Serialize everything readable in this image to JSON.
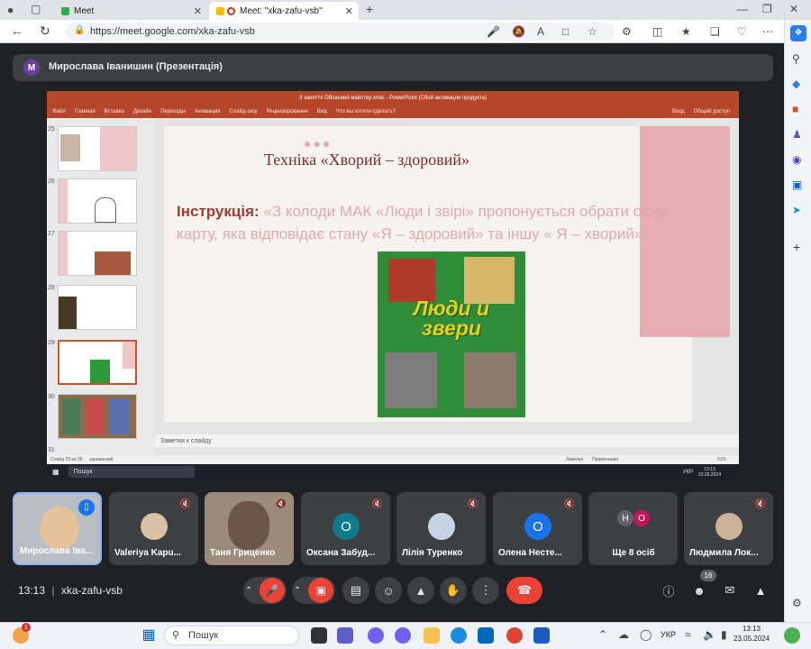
{
  "browser": {
    "tab1_title": "Meet",
    "tab2_title": "Meet: \"xka-zafu-vsb\"",
    "url": "https://meet.google.com/xka-zafu-vsb"
  },
  "meet": {
    "presenter_initial": "M",
    "presenter_label": "Мирослава Іванишин (Презентація)",
    "time": "13:13",
    "meeting_code": "xka-zafu-vsb",
    "people_count": "16"
  },
  "ppt": {
    "window_title": "3 заняття Обласний майстер клас - PowerPoint (Сбой активации продукта)",
    "menu": [
      "Файл",
      "Главная",
      "Вставка",
      "Дизайн",
      "Переходы",
      "Анимация",
      "Слайд-шоу",
      "Рецензирование",
      "Вид",
      "Что вы хотите сделать?"
    ],
    "signin": "Вход",
    "share": "Общий доступ",
    "thumbs": [
      "25",
      "26",
      "27",
      "28",
      "29",
      "30",
      "31"
    ],
    "notes_label": "Заметки к слайду",
    "status_left": "Слайд 29 из 36",
    "status_lang": "украинский",
    "status_notes": "Заметки",
    "status_comments": "Примечания",
    "status_zoom": "61%",
    "taskbar_search": "Пошук",
    "taskbar_time": "13:13",
    "taskbar_date": "23.05.2024",
    "taskbar_lang": "УКР"
  },
  "slide": {
    "title": "Техніка «Хворий – здоровий»",
    "instr_bold": "Інструкція:",
    "instr_text": " «З колоди МАК «Люди і звірі» пропонується обрати одну карту, яка відповідає стану «Я – здоровий» та іншу « Я – хворий»",
    "card_title": "Люди и звери"
  },
  "tiles": [
    {
      "name": "Мирослава Іва...",
      "initial": "",
      "color": ""
    },
    {
      "name": "Valeriya Kapu...",
      "initial": "",
      "color": ""
    },
    {
      "name": "Таня Гриценко",
      "initial": "",
      "color": ""
    },
    {
      "name": "Оксана Забуд...",
      "initial": "О",
      "color": "#0f7c8c"
    },
    {
      "name": "Лілія Туренко",
      "initial": "",
      "color": ""
    },
    {
      "name": "Олена Несте...",
      "initial": "О",
      "color": "#1a73e8"
    },
    {
      "name": "Ще 8 осіб",
      "initial": "",
      "color": ""
    },
    {
      "name": "Людмила Лок...",
      "initial": "",
      "color": ""
    }
  ],
  "more_initials": [
    "Н",
    "О"
  ],
  "windows": {
    "search": "Пошук",
    "lang": "УКР",
    "time": "13:13",
    "date": "23.05.2024",
    "notify_badge": "1"
  }
}
